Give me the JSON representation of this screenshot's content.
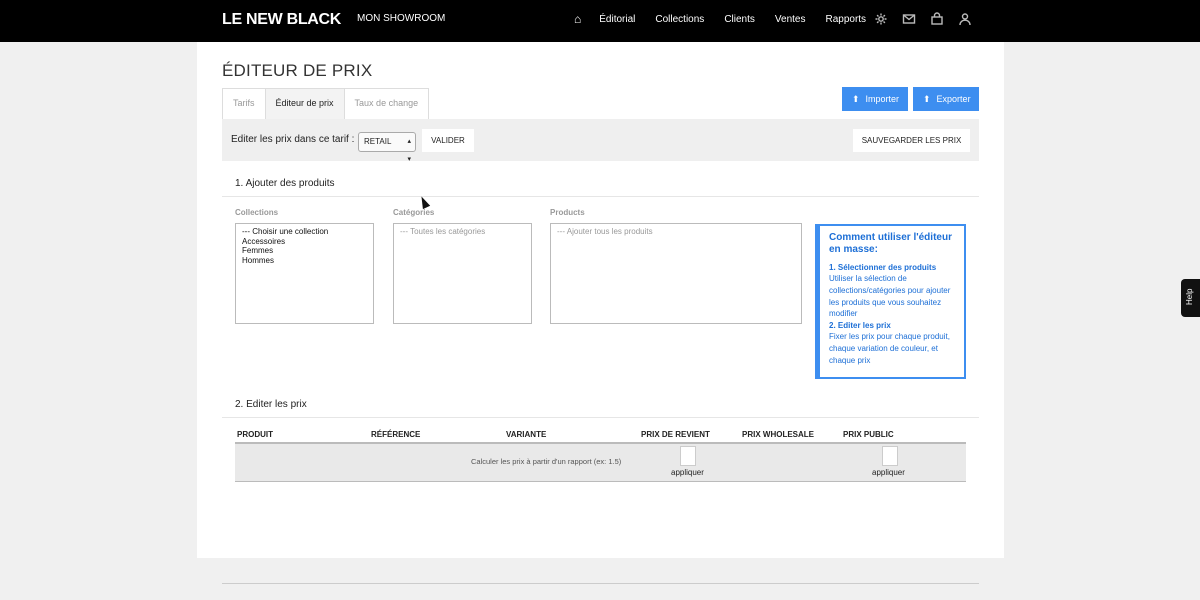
{
  "nav": {
    "logo": "LE NEW BLACK",
    "showroom": "MON SHOWROOM",
    "home_icon": "⌂",
    "items": [
      "Éditorial",
      "Collections",
      "Clients",
      "Ventes",
      "Rapports"
    ],
    "icons": [
      "gear-icon",
      "mail-icon",
      "bag-icon",
      "user-icon"
    ]
  },
  "page": {
    "title": "ÉDITEUR DE PRIX"
  },
  "tabs": [
    "Tarifs",
    "Éditeur de prix",
    "Taux de change"
  ],
  "actions": {
    "import": "Importer",
    "export": "Exporter"
  },
  "toolbar": {
    "label": "Editer les prix dans ce tarif :",
    "select_value": "RETAIL",
    "validate": "VALIDER",
    "save": "SAUVEGARDER LES PRIX"
  },
  "section1": {
    "title": "1. Ajouter des produits",
    "collections_label": "Collections",
    "collections": [
      "--- Choisir une collection",
      "Accessoires",
      "Femmes",
      "Hommes"
    ],
    "categories_label": "Catégories",
    "categories_placeholder": "--- Toutes les catégories",
    "products_label": "Products",
    "products_placeholder": "--- Ajouter tous les produits"
  },
  "help": {
    "title": "Comment utiliser l'éditeur en masse:",
    "step1": "1. Sélectionner des produits",
    "step1_text": "Utiliser la sélection de collections/catégories pour ajouter les produits que vous souhaitez modifier",
    "step2": "2. Editer les prix",
    "step2_text": "Fixer les prix pour chaque produit, chaque variation de couleur, et chaque prix"
  },
  "section2": {
    "title": "2. Editer les prix",
    "columns": [
      "PRODUIT",
      "RÉFÉRENCE",
      "VARIANTE",
      "PRIX DE REVIENT",
      "PRIX WHOLESALE",
      "PRIX PUBLIC"
    ],
    "calc_label": "Calculer les prix à partir d'un rapport (ex: 1.5)",
    "apply": "appliquer"
  },
  "side_tab": "Help",
  "colors": {
    "accent": "#3d8ef0",
    "nav_bg": "#000000"
  }
}
